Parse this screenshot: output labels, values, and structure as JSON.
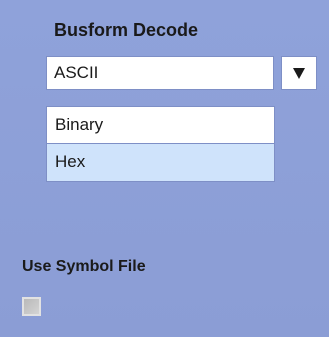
{
  "busform_decode": {
    "title": "Busform Decode",
    "selected_value": "ASCII",
    "arrow_icon": "triangle-down-icon",
    "options": [
      {
        "label": "Binary",
        "highlighted": false
      },
      {
        "label": "Hex",
        "highlighted": true
      }
    ]
  },
  "symbol_file": {
    "label": "Use Symbol File",
    "checked": false
  },
  "colors": {
    "panel_background": "#8ea0d8",
    "highlight": "#cfe3fb"
  }
}
